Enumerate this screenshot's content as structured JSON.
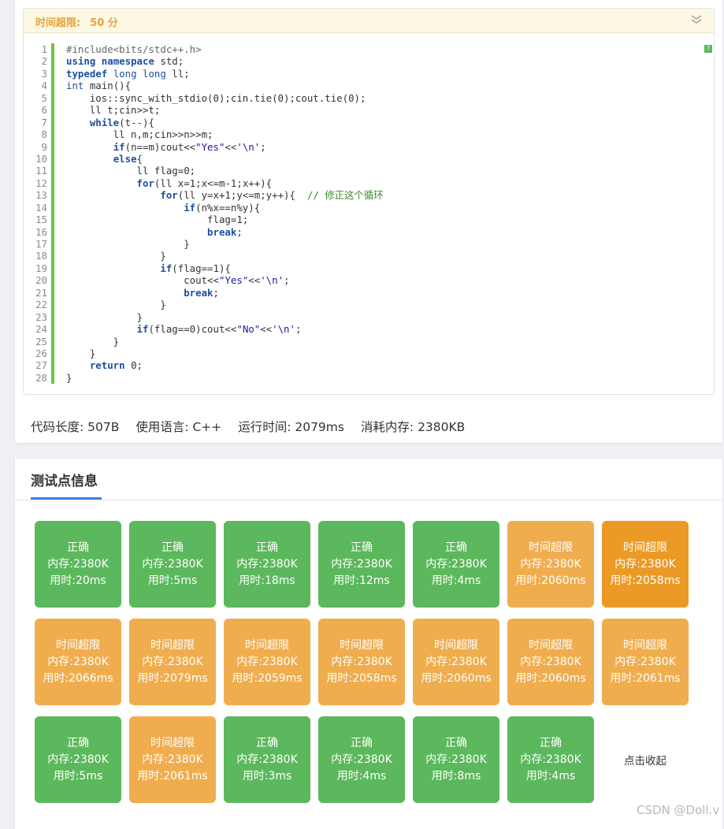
{
  "header": {
    "time_limit_label": "时间超限:",
    "time_limit_value": "50 分"
  },
  "code_lines": [
    "#include<bits/stdc++.h>",
    "using namespace std;",
    "typedef long long ll;",
    "int main(){",
    "    ios::sync_with_stdio(0);cin.tie(0);cout.tie(0);",
    "    ll t;cin>>t;",
    "    while(t--){",
    "        ll n,m;cin>>n>>m;",
    "        if(n==m)cout<<\"Yes\"<<'\\n';",
    "        else{",
    "            ll flag=0;",
    "            for(ll x=1;x<=m-1;x++){",
    "                for(ll y=x+1;y<=m;y++){  // 修正这个循环",
    "                    if(n%x==n%y){",
    "                        flag=1;",
    "                        break;",
    "                    }",
    "                }",
    "                if(flag==1){",
    "                    cout<<\"Yes\"<<'\\n';",
    "                    break;",
    "                }",
    "            }",
    "            if(flag==0)cout<<\"No\"<<'\\n';",
    "        }",
    "    }",
    "    return 0;",
    "}"
  ],
  "stats": {
    "code_length": "代码长度: 507B",
    "language": "使用语言: C++",
    "run_time": "运行时间: 2079ms",
    "memory": "消耗内存: 2380KB"
  },
  "testcases_section": {
    "title": "测试点信息",
    "collapse_label": "点击收起",
    "items": [
      {
        "status": "正确",
        "memory": "内存:2380K",
        "time": "用时:20ms",
        "kind": "ac"
      },
      {
        "status": "正确",
        "memory": "内存:2380K",
        "time": "用时:5ms",
        "kind": "ac"
      },
      {
        "status": "正确",
        "memory": "内存:2380K",
        "time": "用时:18ms",
        "kind": "ac"
      },
      {
        "status": "正确",
        "memory": "内存:2380K",
        "time": "用时:12ms",
        "kind": "ac"
      },
      {
        "status": "正确",
        "memory": "内存:2380K",
        "time": "用时:4ms",
        "kind": "ac"
      },
      {
        "status": "时间超限",
        "memory": "内存:2380K",
        "time": "用时:2060ms",
        "kind": "tle"
      },
      {
        "status": "时间超限",
        "memory": "内存:2380K",
        "time": "用时:2058ms",
        "kind": "tle-dark"
      },
      {
        "status": "时间超限",
        "memory": "内存:2380K",
        "time": "用时:2066ms",
        "kind": "tle"
      },
      {
        "status": "时间超限",
        "memory": "内存:2380K",
        "time": "用时:2079ms",
        "kind": "tle"
      },
      {
        "status": "时间超限",
        "memory": "内存:2380K",
        "time": "用时:2059ms",
        "kind": "tle"
      },
      {
        "status": "时间超限",
        "memory": "内存:2380K",
        "time": "用时:2058ms",
        "kind": "tle"
      },
      {
        "status": "时间超限",
        "memory": "内存:2380K",
        "time": "用时:2060ms",
        "kind": "tle"
      },
      {
        "status": "时间超限",
        "memory": "内存:2380K",
        "time": "用时:2060ms",
        "kind": "tle"
      },
      {
        "status": "时间超限",
        "memory": "内存:2380K",
        "time": "用时:2061ms",
        "kind": "tle"
      },
      {
        "status": "正确",
        "memory": "内存:2380K",
        "time": "用时:5ms",
        "kind": "ac"
      },
      {
        "status": "时间超限",
        "memory": "内存:2380K",
        "time": "用时:2061ms",
        "kind": "tle"
      },
      {
        "status": "正确",
        "memory": "内存:2380K",
        "time": "用时:3ms",
        "kind": "ac"
      },
      {
        "status": "正确",
        "memory": "内存:2380K",
        "time": "用时:4ms",
        "kind": "ac"
      },
      {
        "status": "正确",
        "memory": "内存:2380K",
        "time": "用时:8ms",
        "kind": "ac"
      },
      {
        "status": "正确",
        "memory": "内存:2380K",
        "time": "用时:4ms",
        "kind": "ac"
      }
    ]
  },
  "colors": {
    "accepted": "#5cb85c",
    "time_limit_exceeded": "#f0ad4e",
    "time_limit_exceeded_dark": "#ec9a26",
    "accent_blue": "#3f7de8",
    "gutter_green": "#6cc644"
  },
  "icons": {
    "collapse": "chevron-double-down-icon",
    "help": "question-icon"
  },
  "watermark": "CSDN @Doll.v"
}
